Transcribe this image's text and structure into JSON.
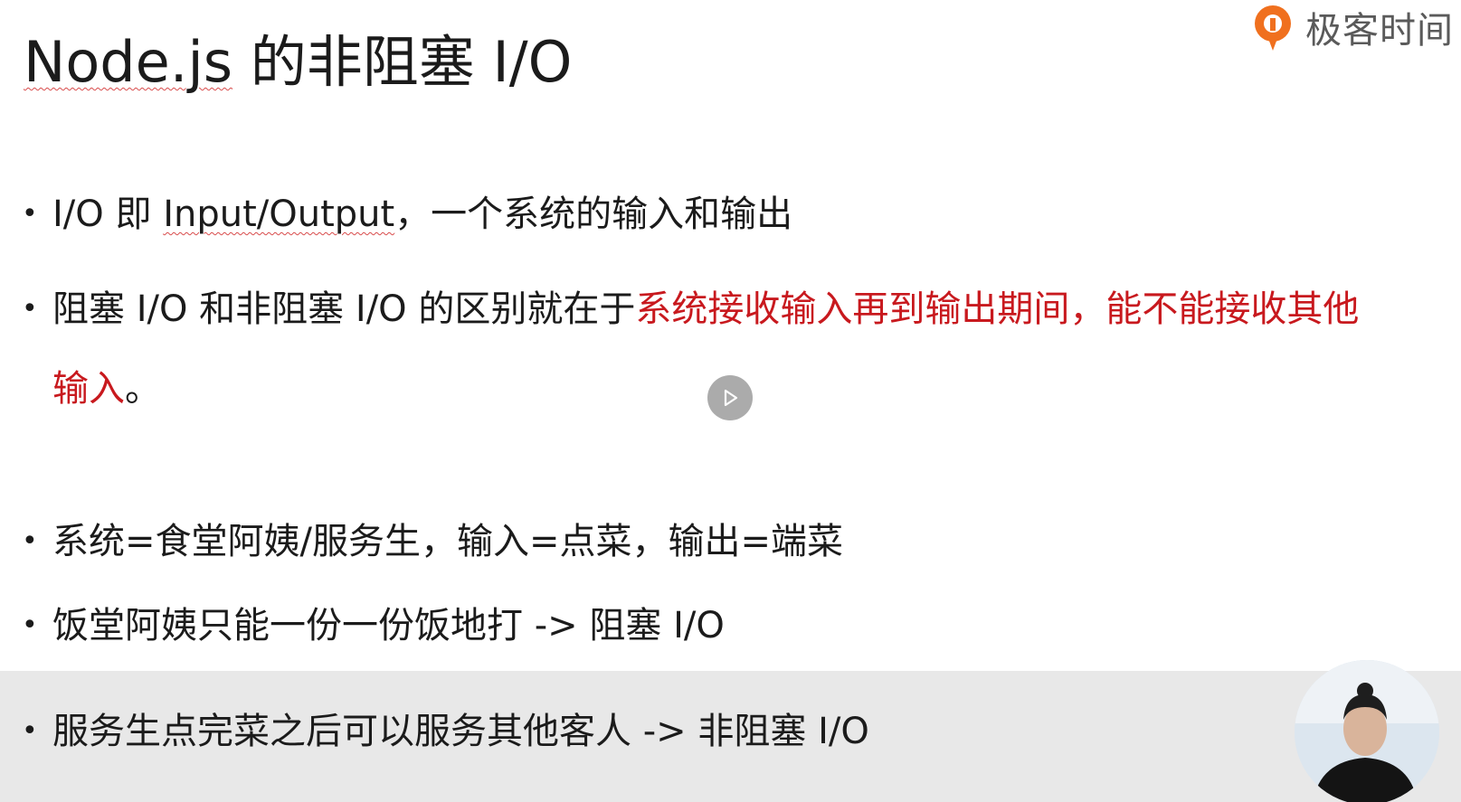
{
  "brand": {
    "name": "极客时间",
    "logo_icon": "geektime-logo-icon",
    "accent": "#f0701e"
  },
  "slide": {
    "title_en": "Node.js",
    "title_rest": " 的非阻塞 I/O",
    "bullets": [
      {
        "pre": "I/O 即 ",
        "underlined": "Input/Output",
        "post": "，一个系统的输入和输出"
      },
      {
        "pre": "阻塞 I/O 和非阻塞 I/O 的区别就在于",
        "highlight": "系统接收输入再到输出期间，能不能接收其他输入",
        "post": "。"
      },
      {
        "text": "系统=食堂阿姨/服务生，输入=点菜，输出=端菜"
      },
      {
        "text": "饭堂阿姨只能一份一份饭地打 -> 阻塞 I/O"
      },
      {
        "text": "服务生点完菜之后可以服务其他客人 -> 非阻塞 I/O"
      }
    ],
    "highlight_color": "#c8191e"
  },
  "player": {
    "play_icon": "play-icon"
  },
  "presenter": {
    "avatar_icon": "presenter-avatar"
  }
}
